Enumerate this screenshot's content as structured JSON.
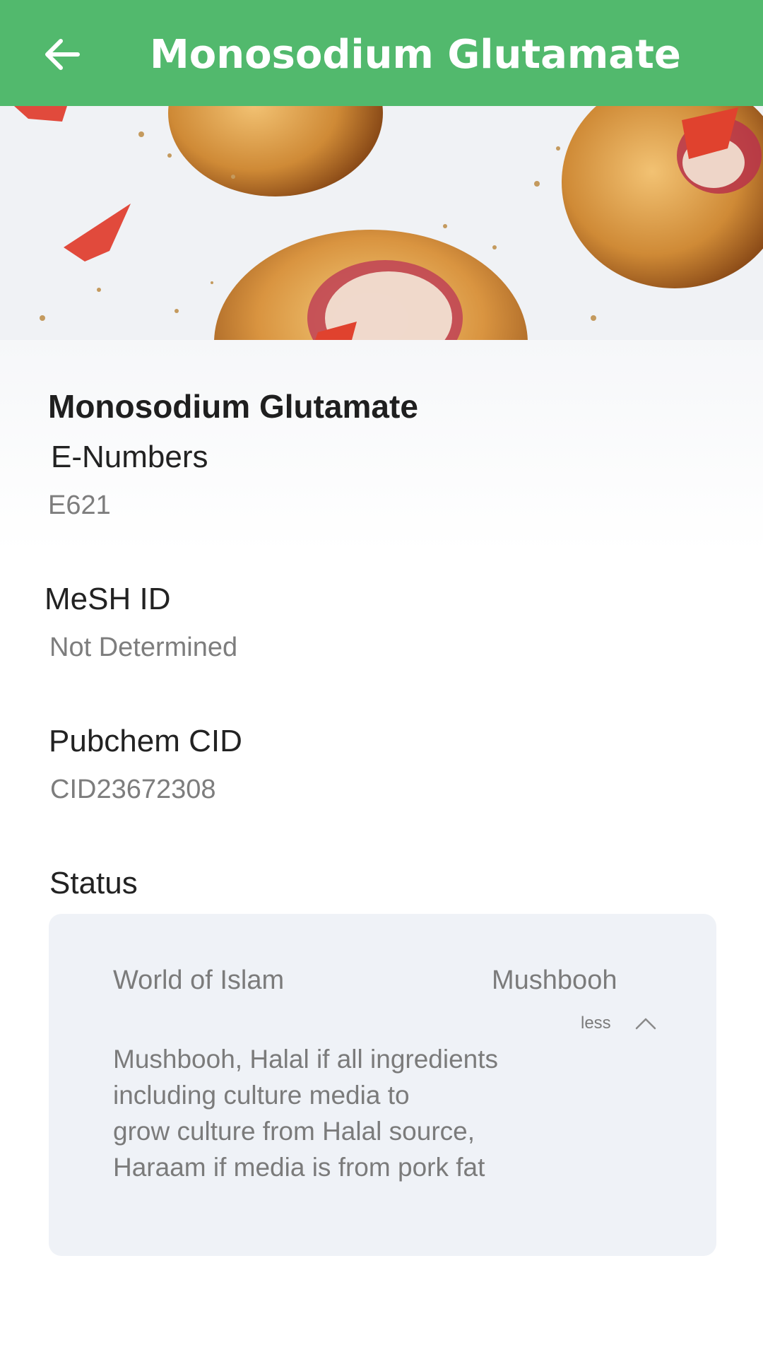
{
  "appbar": {
    "title": "Monosodium Glutamate",
    "back_icon": "arrow-left-icon",
    "color": "#52b96d"
  },
  "hero": {
    "image": "pastry-buns-photo"
  },
  "ingredient": {
    "name": "Monosodium Glutamate",
    "fields": {
      "enumbers": {
        "label": "E-Numbers",
        "value": "E621"
      },
      "mesh": {
        "label": "MeSH ID",
        "value": "Not Determined"
      },
      "pubchem": {
        "label": "Pubchem CID",
        "value": "CID23672308"
      }
    }
  },
  "status": {
    "label": "Status",
    "source": "World of Islam",
    "value": "Mushbooh",
    "toggle_label": "less",
    "toggle_icon": "chevron-up-icon",
    "description_lines": [
      "Mushbooh, Halal if all ingredients",
      "including culture media to",
      "grow culture from Halal source,",
      "Haraam if media is from pork fat"
    ]
  }
}
